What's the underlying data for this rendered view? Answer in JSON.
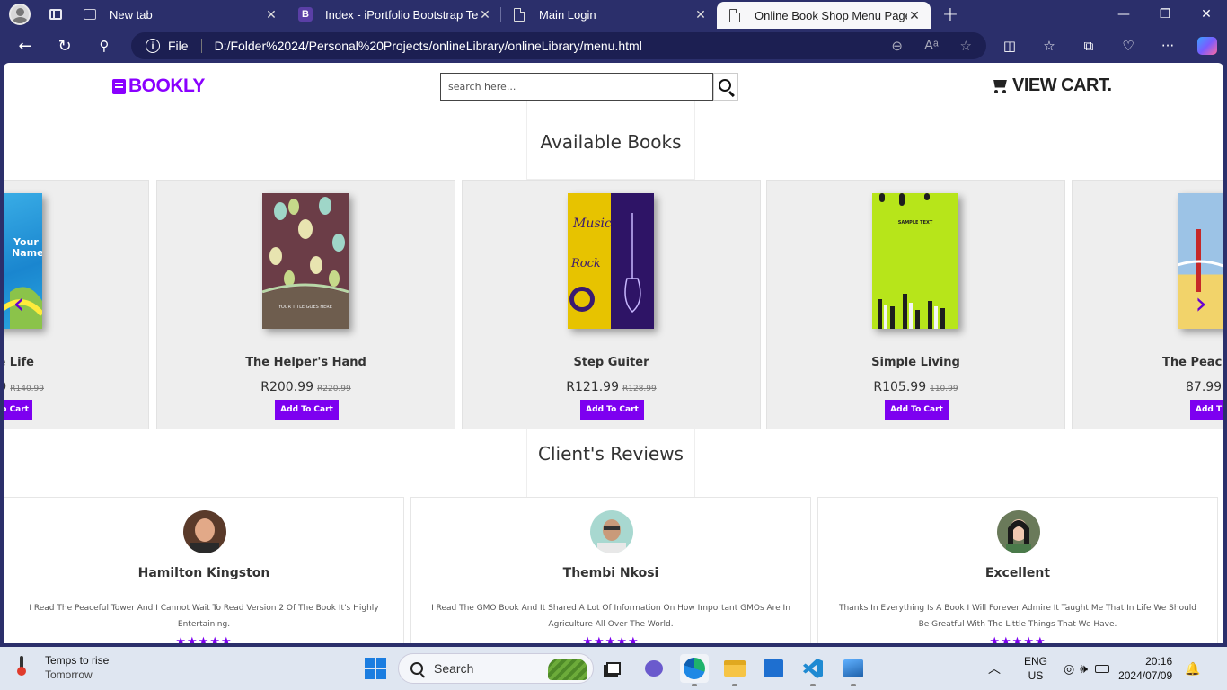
{
  "browser": {
    "tabs": [
      {
        "title": "New tab",
        "icon": "new-tab-icon",
        "active": false
      },
      {
        "title": "Index - iPortfolio Bootstrap Temp",
        "icon": "bootstrap-icon",
        "active": false
      },
      {
        "title": "Main Login",
        "icon": "document-icon",
        "active": false
      },
      {
        "title": "Online Book Shop Menu Page",
        "icon": "document-icon",
        "active": true
      }
    ],
    "url_scheme_label": "File",
    "url": "D:/Folder%2024/Personal%20Projects/onlineLibrary/onlineLibrary/menu.html"
  },
  "site": {
    "logo": "BOOKLY",
    "search_placeholder": "search here...",
    "cart_label": "VIEW CART.",
    "accent": "#8a00ff"
  },
  "books_section": {
    "title": "Available Books",
    "add_label": "Add To Cart",
    "partial_left": {
      "name": "e Life",
      "price": "9",
      "old_price": "R140.99",
      "add_label": "o Cart"
    },
    "books": [
      {
        "name": "The Helper's Hand",
        "price": "R200.99",
        "old_price": "R220.99",
        "cover": "hands"
      },
      {
        "name": "Step Guiter",
        "price": "R121.99",
        "old_price": "R128.99",
        "cover": "music"
      },
      {
        "name": "Simple Living",
        "price": "R105.99",
        "old_price": "110.99",
        "cover": "lime"
      }
    ],
    "partial_right": {
      "name": "The Peac",
      "price": "87.99",
      "add_label": "Add T"
    }
  },
  "reviews_section": {
    "title": "Client's Reviews",
    "reviews": [
      {
        "name": "Hamilton Kingston",
        "text": "I Read The Peaceful Tower And I Cannot Wait To Read Version 2 Of The Book It's Highly Entertaining.",
        "stars": "★★★★★"
      },
      {
        "name": "Thembi Nkosi",
        "text": "I Read The GMO Book And It Shared A Lot Of Information On How Important GMOs Are In Agriculture All Over The World.",
        "stars": "★★★★★"
      },
      {
        "name": "Excellent",
        "text": "Thanks In Everything Is A Book I Will Forever Admire It Taught Me That In Life We Should Be Greatful With The Little Things That We Have.",
        "stars": "★★★★★"
      }
    ]
  },
  "taskbar": {
    "weather_line1": "Temps to rise",
    "weather_line2": "Tomorrow",
    "search_label": "Search",
    "lang_line1": "ENG",
    "lang_line2": "US",
    "time": "20:16",
    "date": "2024/07/09"
  }
}
